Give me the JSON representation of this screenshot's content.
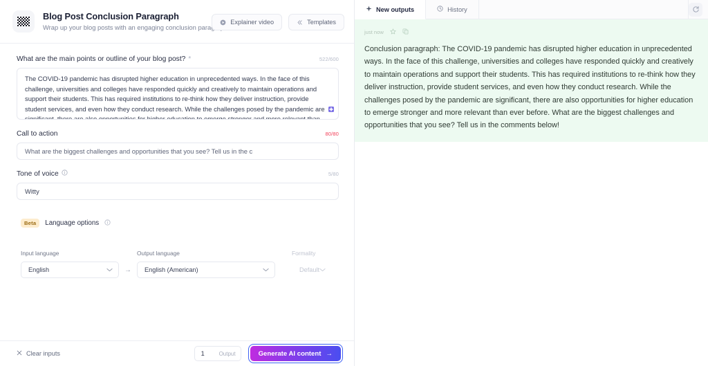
{
  "header": {
    "app_title": "Blog Post Conclusion Paragraph",
    "app_subtitle": "Wrap up your blog posts with an engaging conclusion paragraph.",
    "app_icon": "checkerboard-icon",
    "buttons": [
      {
        "label": "Explainer video",
        "icon": "play-circle-icon"
      },
      {
        "label": "Templates",
        "icon": "chevrons-left-icon"
      }
    ]
  },
  "form": {
    "main_points": {
      "label": "What are the main points or outline of your blog post?",
      "required_marker": "*",
      "counter": "522/600",
      "value": "The COVID-19 pandemic has disrupted higher education in unprecedented ways. In the face of this challenge, universities and colleges have responded quickly and creatively to maintain operations and support their students. This has required institutions to re-think how they deliver instruction, provide student services, and even how they conduct research. While the challenges posed by the pandemic are significant, there are also opportunities for higher education to emerge stronger and more relevant than ever before.",
      "corner_icon": "resize-grip-icon"
    },
    "call_to_action": {
      "label": "Call to action",
      "counter": "80/80",
      "counter_state": "limit",
      "value": "What are the biggest challenges and opportunities that you see? Tell us in the c"
    },
    "tone_of_voice": {
      "label": "Tone of voice",
      "info_icon": "info-icon",
      "counter": "5/80",
      "value": "Witty"
    },
    "language_options": {
      "badge": "Beta",
      "title": "Language options",
      "info_icon": "info-icon",
      "input_language": {
        "label": "Input language",
        "value": "English"
      },
      "arrow": "→",
      "output_language": {
        "label": "Output language",
        "value": "English (American)"
      },
      "formality": {
        "label": "Formality",
        "value": "Default",
        "disabled": true
      }
    }
  },
  "bottom_bar": {
    "clear_label": "Clear inputs",
    "clear_icon": "close-icon",
    "output_count": "1",
    "output_label": "Output",
    "generate_label": "Generate AI content",
    "generate_arrow": "→"
  },
  "output_panel": {
    "tabs": [
      {
        "label": "New outputs",
        "icon": "sparkle-icon",
        "active": true
      },
      {
        "label": "History",
        "icon": "clock-icon",
        "active": false
      }
    ],
    "refresh_icon": "refresh-icon",
    "card": {
      "timestamp": "just now",
      "star_icon": "star-icon",
      "copy_icon": "copy-icon",
      "text": "Conclusion paragraph: The COVID-19 pandemic has disrupted higher education in unprecedented ways. In the face of this challenge, universities and colleges have responded quickly and creatively to maintain operations and support their students. This has required institutions to re-think how they deliver instruction, provide student services, and even how they conduct research. While the challenges posed by the pandemic are significant, there are also opportunities for higher education to emerge stronger and more relevant than ever before. What are the biggest challenges and opportunities that you see? Tell us in the comments below!"
    }
  },
  "colors": {
    "accent_purple": "#8b3ae8",
    "accent_blue": "#4a4ef0",
    "focus_ring": "#3f62f5",
    "output_bg": "#edfaf1",
    "limit_red": "#f2415a",
    "beta_bg": "#fdeccd"
  }
}
